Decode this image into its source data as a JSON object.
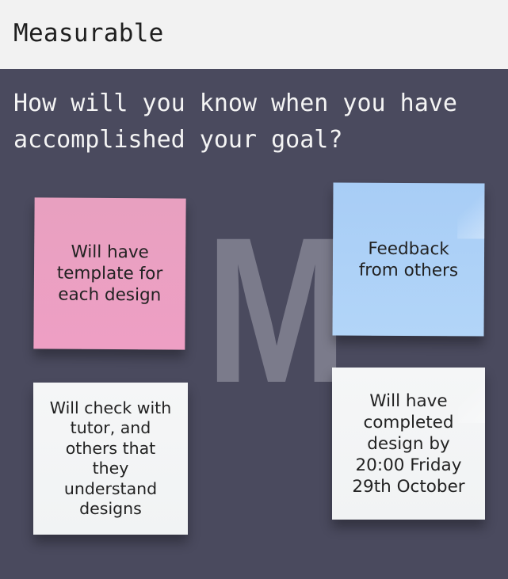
{
  "header": {
    "title": "Measurable"
  },
  "board": {
    "question": "How will you know when you have accomplished your goal?",
    "letter": "M",
    "notes": [
      {
        "color": "#ee9fc4",
        "text": "Will have\ntemplate for\neach design"
      },
      {
        "color": "#a8cdf6",
        "text": "Feedback\nfrom others"
      },
      {
        "color": "#f3f4f5",
        "text": "Will check with\ntutor, and\nothers that\nthey\nunderstand\ndesigns"
      },
      {
        "color": "#f3f4f5",
        "text": "Will have\ncompleted\ndesign by\n20:00  Friday\n29th October"
      }
    ]
  },
  "colors": {
    "background": "#4a4a5e",
    "header_background": "#f2f2f2",
    "letter": "#7b7b8b"
  }
}
